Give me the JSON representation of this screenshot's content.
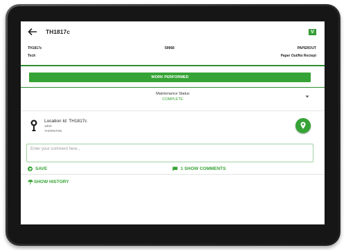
{
  "appbar": {
    "title": "TH1817c",
    "brand_icon": "V"
  },
  "info": {
    "row1": {
      "left": "TH1817c",
      "middle": "59968",
      "right": "PAPEROUT"
    },
    "row2": {
      "left": "Tech",
      "right": "Paper Out/No Reciept"
    }
  },
  "work_button_label": "WORK PERFORMED",
  "maintenance": {
    "label": "Maintenance Status",
    "value": "COMPLETE"
  },
  "location": {
    "title": "Location Id: TH1817c",
    "line2": "1800",
    "line3": "THORNTON"
  },
  "comment": {
    "placeholder": "Enter your comment here..."
  },
  "actions": {
    "save_label": "SAVE",
    "show_comments_label": "1 SHOW COMMENTS"
  },
  "history_label": "SHOW HISTORY",
  "icons": [
    "back-arrow-icon",
    "brand-logo-icon",
    "chevron-down-icon",
    "parking-meter-icon",
    "map-pin-icon",
    "add-icon",
    "chat-icon",
    "umbrella-icon"
  ],
  "colors": {
    "accent": "#35a335",
    "divider": "#2e8b2e"
  }
}
